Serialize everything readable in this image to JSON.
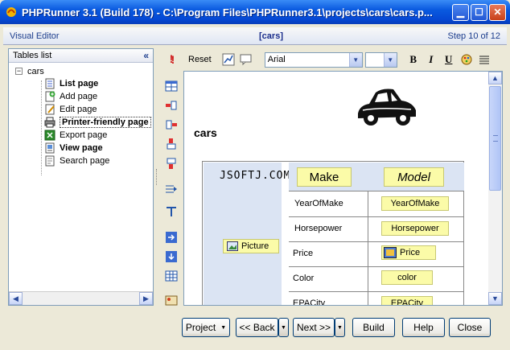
{
  "window": {
    "title": "PHPRunner 3.1 (Build 178) - C:\\Program Files\\PHPRunner3.1\\projects\\cars\\cars.p..."
  },
  "header": {
    "left": "Visual Editor",
    "center": "[cars]",
    "right": "Step 10 of 12"
  },
  "tables_panel": {
    "title": "Tables list",
    "collapse": "«",
    "root": {
      "expander": "−",
      "label": "cars"
    },
    "items": [
      {
        "label": "List page",
        "bold": true,
        "icon": "list-page-icon"
      },
      {
        "label": "Add page",
        "bold": false,
        "icon": "add-page-icon"
      },
      {
        "label": "Edit page",
        "bold": false,
        "icon": "edit-page-icon"
      },
      {
        "label": "Printer-friendly page",
        "bold": true,
        "icon": "printer-icon",
        "selected": true
      },
      {
        "label": "Export page",
        "bold": false,
        "icon": "export-icon"
      },
      {
        "label": "View page",
        "bold": true,
        "icon": "view-page-icon"
      },
      {
        "label": "Search page",
        "bold": false,
        "icon": "search-page-icon"
      }
    ]
  },
  "toolbar": {
    "reset": "Reset",
    "font": "Arial",
    "size": "",
    "bold": "B",
    "italic": "I",
    "underline": "U"
  },
  "canvas": {
    "title": "cars",
    "watermark": "JSOFTJ.COM",
    "header_fields": {
      "make": "Make",
      "model": "Model"
    },
    "picture": "Picture",
    "rows": [
      {
        "label": "YearOfMake",
        "field": "YearOfMake"
      },
      {
        "label": "Horsepower",
        "field": "Horsepower"
      },
      {
        "label": "Price",
        "field": "Price"
      },
      {
        "label": "Color",
        "field": "color"
      },
      {
        "label": "EPACity",
        "field": "EPACity"
      }
    ]
  },
  "buttons": {
    "project": "Project",
    "back": "<< Back",
    "next": "Next >>",
    "build": "Build",
    "help": "Help",
    "close": "Close"
  },
  "colors": {
    "titlebar": "#0a5ae0",
    "field_yellow": "#fbfba8",
    "grid_blue": "#dbe4f3"
  }
}
